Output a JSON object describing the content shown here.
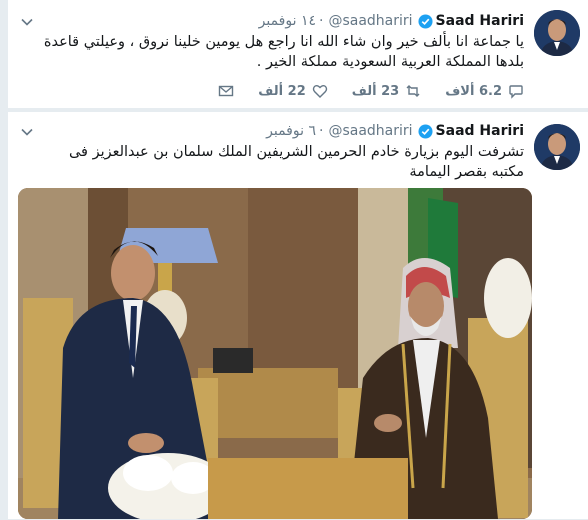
{
  "tweets": [
    {
      "author": {
        "name": "Saad Hariri",
        "handle": "@saadhariri"
      },
      "time": "١٤ نوفمبر",
      "text": "يا جماعة انا بألف خير وان شاء الله انا راجع هل يومين خلينا نروق ، وعيلتي قاعدة بلدها المملكة العربية السعودية مملكة الخير .",
      "actions": {
        "reply": "6.2 ألاف",
        "retweet": "23 ألف",
        "like": "22 ألف"
      }
    },
    {
      "author": {
        "name": "Saad Hariri",
        "handle": "@saadhariri"
      },
      "time": "٦ نوفمبر",
      "text": "تشرفت اليوم بزيارة خادم الحرمين الشريفين الملك سلمان بن عبدالعزيز فى مكتبه بقصر اليمامة"
    }
  ],
  "icons": {
    "verified": "verified-badge-icon",
    "reply": "reply-icon",
    "retweet": "retweet-icon",
    "like": "heart-icon",
    "dm": "envelope-icon",
    "more": "chevron-down-icon"
  },
  "colors": {
    "muted": "#657786",
    "verified": "#1da1f2",
    "text": "#14171a"
  }
}
